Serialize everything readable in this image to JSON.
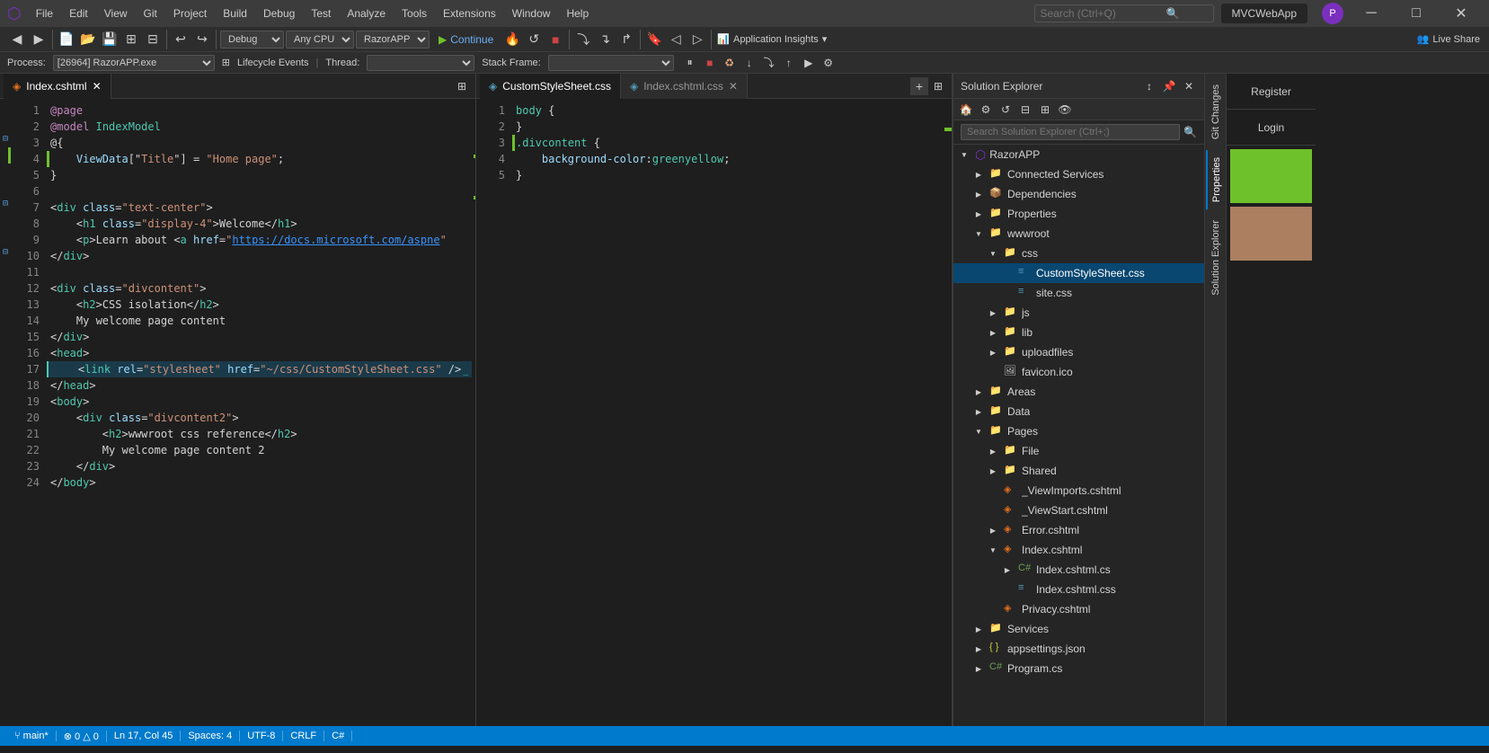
{
  "titleBar": {
    "icon": "VS",
    "menus": [
      "File",
      "Edit",
      "View",
      "Git",
      "Project",
      "Build",
      "Debug",
      "Test",
      "Analyze",
      "Tools",
      "Extensions",
      "Window",
      "Help"
    ],
    "searchPlaceholder": "Search (Ctrl+Q)",
    "windowTitle": "MVCWebApp",
    "profileInitial": "P"
  },
  "toolbar": {
    "debugMode": "Debug",
    "platform": "Any CPU",
    "launchProfile": "RazorAPP",
    "continueLabel": "Continue",
    "insightsLabel": "Application Insights",
    "liveShareLabel": "Live Share"
  },
  "processBar": {
    "label": "Process:",
    "processValue": "[26964] RazorAPP.exe",
    "lifecycleLabel": "Lifecycle Events",
    "threadLabel": "Thread:",
    "stackFrameLabel": "Stack Frame:"
  },
  "tabs": [
    {
      "label": "Index.cshtml",
      "active": true,
      "dirty": false
    },
    {
      "label": "CustomStyleSheet.css",
      "active": false,
      "dirty": false
    },
    {
      "label": "Index.cshtml.css",
      "active": false,
      "dirty": false
    }
  ],
  "leftEditor": {
    "filename": "Index.cshtml",
    "lines": [
      {
        "num": 1,
        "code": "@page"
      },
      {
        "num": 2,
        "code": "@model IndexModel"
      },
      {
        "num": 3,
        "code": "@{"
      },
      {
        "num": 4,
        "code": "    ViewData[\"Title\"] = \"Home page\";",
        "highlight": true
      },
      {
        "num": 5,
        "code": "}"
      },
      {
        "num": 6,
        "code": ""
      },
      {
        "num": 7,
        "code": "<div class=\"text-center\">"
      },
      {
        "num": 8,
        "code": "    <h1 class=\"display-4\">Welcome</h1>"
      },
      {
        "num": 9,
        "code": "    <p>Learn about <a href=\"https://docs.microsoft.com/aspne"
      },
      {
        "num": 10,
        "code": "</div>"
      },
      {
        "num": 11,
        "code": ""
      },
      {
        "num": 12,
        "code": "<div class=\"divcontent\">"
      },
      {
        "num": 13,
        "code": "    <h2>CSS isolation</h2>"
      },
      {
        "num": 14,
        "code": "    My welcome page content"
      },
      {
        "num": 15,
        "code": "</div>"
      },
      {
        "num": 16,
        "code": "<head>"
      },
      {
        "num": 17,
        "code": "    <link rel=\"stylesheet\" href=\"~/css/CustomStyleSheet.css\" />"
      },
      {
        "num": 18,
        "code": "</head>"
      },
      {
        "num": 19,
        "code": "<body>"
      },
      {
        "num": 20,
        "code": "    <div class=\"divcontent2\">"
      },
      {
        "num": 21,
        "code": "        <h2>wwwroot css reference</h2>"
      },
      {
        "num": 22,
        "code": "        My welcome page content 2"
      },
      {
        "num": 23,
        "code": "    </div>"
      },
      {
        "num": 24,
        "code": "</body>"
      }
    ]
  },
  "rightEditor": {
    "filename": "CustomStyleSheet.css",
    "lines": [
      {
        "num": 1,
        "code": "body {"
      },
      {
        "num": 2,
        "code": "}"
      },
      {
        "num": 3,
        "code": ".divcontent {"
      },
      {
        "num": 4,
        "code": "    background-color:greenyellow;"
      },
      {
        "num": 5,
        "code": "}"
      }
    ]
  },
  "solutionExplorer": {
    "title": "Solution Explorer",
    "searchPlaceholder": "Search Solution Explorer (Ctrl+;)",
    "tree": {
      "root": "RazorAPP",
      "items": [
        {
          "label": "Connected Services",
          "type": "folder",
          "level": 1,
          "expanded": false
        },
        {
          "label": "Dependencies",
          "type": "folder",
          "level": 1,
          "expanded": false
        },
        {
          "label": "Properties",
          "type": "folder",
          "level": 1,
          "expanded": false
        },
        {
          "label": "wwwroot",
          "type": "folder",
          "level": 1,
          "expanded": true
        },
        {
          "label": "css",
          "type": "folder",
          "level": 2,
          "expanded": true
        },
        {
          "label": "CustomStyleSheet.css",
          "type": "css",
          "level": 3,
          "selected": true
        },
        {
          "label": "site.css",
          "type": "css",
          "level": 3
        },
        {
          "label": "js",
          "type": "folder",
          "level": 2,
          "expanded": false
        },
        {
          "label": "lib",
          "type": "folder",
          "level": 2,
          "expanded": false
        },
        {
          "label": "uploadfiles",
          "type": "folder",
          "level": 2,
          "expanded": false
        },
        {
          "label": "favicon.ico",
          "type": "ico",
          "level": 2
        },
        {
          "label": "Areas",
          "type": "folder",
          "level": 1,
          "expanded": false
        },
        {
          "label": "Data",
          "type": "folder",
          "level": 1,
          "expanded": false
        },
        {
          "label": "Pages",
          "type": "folder",
          "level": 1,
          "expanded": true
        },
        {
          "label": "File",
          "type": "folder",
          "level": 2,
          "expanded": false
        },
        {
          "label": "Shared",
          "type": "folder",
          "level": 2,
          "expanded": false
        },
        {
          "label": "_ViewImports.cshtml",
          "type": "html",
          "level": 2
        },
        {
          "label": "_ViewStart.cshtml",
          "type": "html",
          "level": 2
        },
        {
          "label": "Error.cshtml",
          "type": "html",
          "level": 2
        },
        {
          "label": "Index.cshtml",
          "type": "html",
          "level": 2,
          "expanded": true
        },
        {
          "label": "Index.cshtml.cs",
          "type": "cs",
          "level": 3
        },
        {
          "label": "Index.cshtml.css",
          "type": "css",
          "level": 3
        },
        {
          "label": "Privacy.cshtml",
          "type": "html",
          "level": 2
        },
        {
          "label": "Services",
          "type": "folder",
          "level": 1,
          "expanded": false
        },
        {
          "label": "appsettings.json",
          "type": "json",
          "level": 1
        },
        {
          "label": "Program.cs",
          "type": "cs",
          "level": 1
        }
      ]
    }
  },
  "rightTabs": [
    "Git Changes",
    "Properties",
    "Solution Explorer"
  ],
  "farRight": {
    "registerLabel": "Register",
    "loginLabel": "Login",
    "swatches": [
      "#6fc12b",
      "#e8a87c"
    ]
  },
  "statusBar": {
    "items": [
      "",
      "Ln 17, Col 45",
      "Spaces: 4",
      "UTF-8",
      "CRLF",
      "C#",
      "main*"
    ]
  }
}
